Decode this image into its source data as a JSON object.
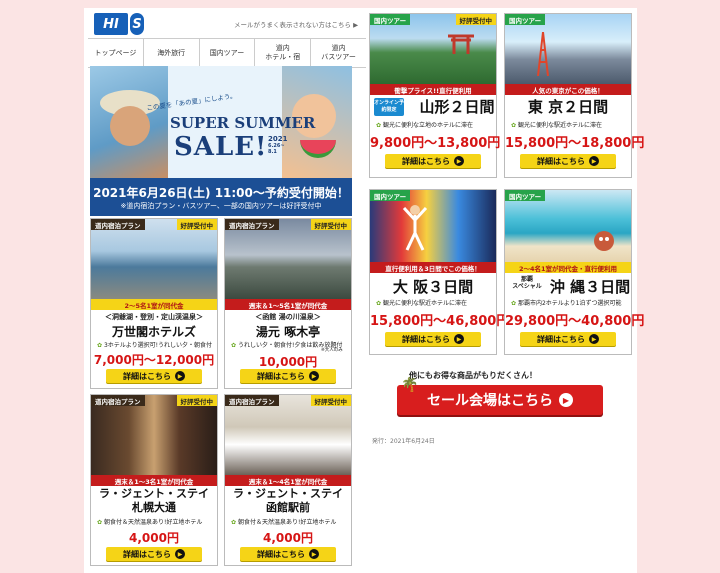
{
  "header": {
    "logo_text": "HIS",
    "logo_main": "HI",
    "logo_s": "S",
    "mail_note": "メールがうまく表示されない方はこちら ▶"
  },
  "nav": [
    {
      "label": "トップページ"
    },
    {
      "label": "海外旅行"
    },
    {
      "label": "国内ツアー"
    },
    {
      "label": "道内\nホテル・宿"
    },
    {
      "label": "道内\nバスツアー"
    }
  ],
  "hero": {
    "copy": "この夏を「あの夏」にしよう。",
    "title_line1": "SUPER SUMMER",
    "title_line2": "SALE!",
    "year": "2021",
    "dates": "6.26~\n8.1",
    "banner_main": "2021年6月26日(土) 11:00～予約受付開始！",
    "banner_sub": "※道内宿泊プラン・バスツアー、一部の国内ツアーは好評受付中"
  },
  "tours": [
    {
      "tag": "国内ツアー",
      "badge": "好評受付中",
      "strip": "衝撃プライス!!直行便利用",
      "online": "オンライン予約限定",
      "name": "山形２日間",
      "desc": "観光に便利な立地のホテルに滞在",
      "price": "9,800円～13,800円",
      "button": "詳細はこちら",
      "icon": "torii-icon"
    },
    {
      "tag": "国内ツアー",
      "badge": "",
      "strip": "人気の東京がこの価格！",
      "online": "",
      "name": "東 京２日間",
      "desc": "観光に便利な駅近ホテルに滞在",
      "price": "15,800円～18,800円",
      "button": "詳細はこちら",
      "icon": "tower-icon"
    },
    {
      "tag": "国内ツアー",
      "badge": "",
      "strip": "直行便利用＆3日間でこの価格！",
      "online": "",
      "name": "大 阪３日間",
      "desc": "観光に便利な駅近ホテルに滞在",
      "price": "15,800円～46,800円",
      "button": "詳細はこちら",
      "icon": "glico-icon"
    },
    {
      "tag": "国内ツアー",
      "badge": "",
      "strip": "2～4名1室が同代金・直行便利用",
      "online": "那覇\nスペシャル",
      "name": "沖 縄３日間",
      "desc": "那覇市内2ホテルより1泊ずつ選択可能",
      "price": "29,800円～40,800円",
      "button": "詳細はこちら",
      "icon": "beach-icon"
    }
  ],
  "hotels": [
    {
      "tag": "道内宿泊プラン",
      "badge": "好評受付中",
      "strip": "2～5名1室が同代金",
      "area": "＜洞爺湖・登別・定山渓温泉＞",
      "name": "万世閣ホテルズ",
      "desc": "3ホテルより選択可!うれしい夕・朝食付",
      "price": "7,000円～12,000円",
      "button": "詳細はこちら"
    },
    {
      "tag": "道内宿泊プラン",
      "badge": "好評受付中",
      "strip": "週末＆1～5名1室が同代金",
      "area": "＜函館 湯の川温泉＞",
      "name": "湯元 啄木亭",
      "desc": "うれしい夕・朝食付!夕食は飲み放題付",
      "note": "※大人のみ",
      "price": "10,000円",
      "button": "詳細はこちら"
    },
    {
      "tag": "道内宿泊プラン",
      "badge": "好評受付中",
      "strip": "週末＆1～3名1室が同代金",
      "area": "",
      "name": "ラ・ジェント・ステイ\n札幌大通",
      "desc": "朝食付＆天然温泉あり!好立地ホテル",
      "price": "4,000円",
      "button": "詳細はこちら"
    },
    {
      "tag": "道内宿泊プラン",
      "badge": "好評受付中",
      "strip": "週末＆1～4名1室が同代金",
      "area": "",
      "name": "ラ・ジェント・ステイ\n函館駅前",
      "desc": "朝食付＆天然温泉あり!好立地ホテル",
      "price": "4,000円",
      "button": "詳細はこちら"
    }
  ],
  "more": {
    "note": "他にもお得な商品がもりだくさん！",
    "sale_button": "セール会場はこちら",
    "issued": "発行：2021年6月24日"
  },
  "colors": {
    "brand_blue": "#1660b8",
    "sale_red": "#d81e1e",
    "accent_yellow": "#f5d417"
  }
}
